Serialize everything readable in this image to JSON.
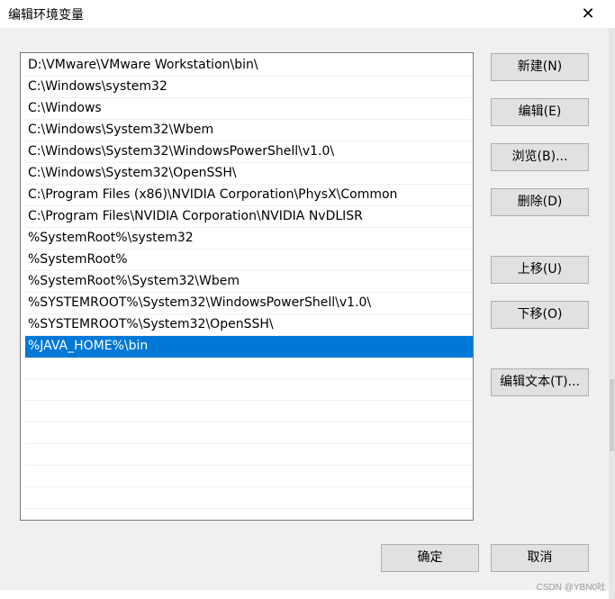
{
  "window": {
    "title": "编辑环境变量",
    "close_label": "✕"
  },
  "paths": [
    "D:\\VMware\\VMware Workstation\\bin\\",
    "C:\\Windows\\system32",
    "C:\\Windows",
    "C:\\Windows\\System32\\Wbem",
    "C:\\Windows\\System32\\WindowsPowerShell\\v1.0\\",
    "C:\\Windows\\System32\\OpenSSH\\",
    "C:\\Program Files (x86)\\NVIDIA Corporation\\PhysX\\Common",
    "C:\\Program Files\\NVIDIA Corporation\\NVIDIA NvDLISR",
    "%SystemRoot%\\system32",
    "%SystemRoot%",
    "%SystemRoot%\\System32\\Wbem",
    "%SYSTEMROOT%\\System32\\WindowsPowerShell\\v1.0\\",
    "%SYSTEMROOT%\\System32\\OpenSSH\\",
    "%JAVA_HOME%\\bin",
    "",
    "",
    "",
    "",
    "",
    "",
    "",
    ""
  ],
  "selected_index": 13,
  "buttons": {
    "new": "新建(N)",
    "edit": "编辑(E)",
    "browse": "浏览(B)...",
    "delete": "删除(D)",
    "move_up": "上移(U)",
    "move_down": "下移(O)",
    "edit_text": "编辑文本(T)...",
    "ok": "确定",
    "cancel": "取消"
  },
  "watermark": "CSDN @YBN0吐",
  "colors": {
    "selection": "#0078d7",
    "button_face": "#e1e1e1"
  }
}
